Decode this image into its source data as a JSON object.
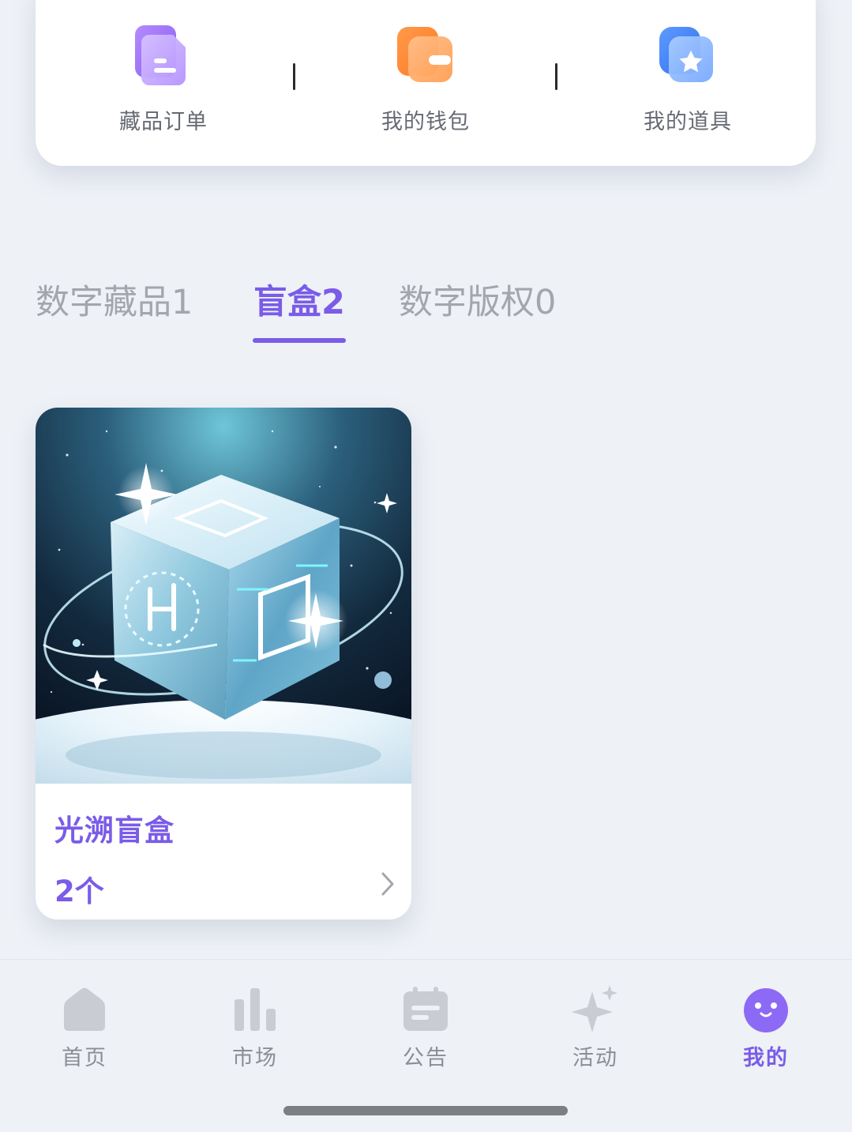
{
  "shortcuts": [
    {
      "label": "藏品订单",
      "icon": "document-icon",
      "color": "#9b6cf0"
    },
    {
      "label": "我的钱包",
      "icon": "wallet-icon",
      "color": "#ff8a3d"
    },
    {
      "label": "我的道具",
      "icon": "star-card-icon",
      "color": "#4c8dff"
    }
  ],
  "tabs": [
    {
      "label": "数字藏品1",
      "active": false
    },
    {
      "label": "盲盒2",
      "active": true
    },
    {
      "label": "数字版权0",
      "active": false
    }
  ],
  "blind_box": {
    "title": "光溯盲盒",
    "count": "2个",
    "image": "crystal-cube-in-space-image"
  },
  "bottom_nav": [
    {
      "label": "首页",
      "icon": "home-icon",
      "active": false
    },
    {
      "label": "市场",
      "icon": "bar-chart-icon",
      "active": false
    },
    {
      "label": "公告",
      "icon": "calendar-notice-icon",
      "active": false
    },
    {
      "label": "活动",
      "icon": "sparkle-icon",
      "active": false
    },
    {
      "label": "我的",
      "icon": "smiley-profile-icon",
      "active": true
    }
  ],
  "colors": {
    "accent": "#7a5ce8",
    "background": "#eef1f6",
    "inactive_text": "#a3a6ad",
    "nav_icon_inactive": "#c9ccd3"
  }
}
